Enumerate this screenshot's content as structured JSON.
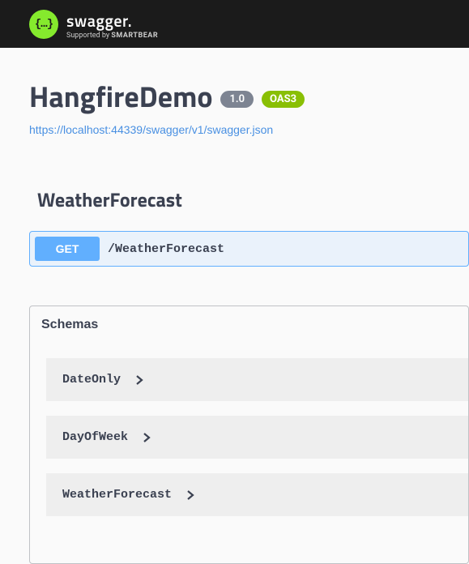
{
  "topbar": {
    "brand": "swagger",
    "tm": ".",
    "supported_prefix": "Supported by ",
    "supported_name": "SMARTBEAR"
  },
  "header": {
    "title": "HangfireDemo",
    "version": "1.0",
    "oas": "OAS3",
    "spec_url": "https://localhost:44339/swagger/v1/swagger.json"
  },
  "tag": {
    "name": "WeatherForecast"
  },
  "operation": {
    "method": "GET",
    "path": "/WeatherForecast"
  },
  "schemas": {
    "title": "Schemas",
    "items": [
      {
        "name": "DateOnly"
      },
      {
        "name": "DayOfWeek"
      },
      {
        "name": "WeatherForecast"
      }
    ]
  }
}
